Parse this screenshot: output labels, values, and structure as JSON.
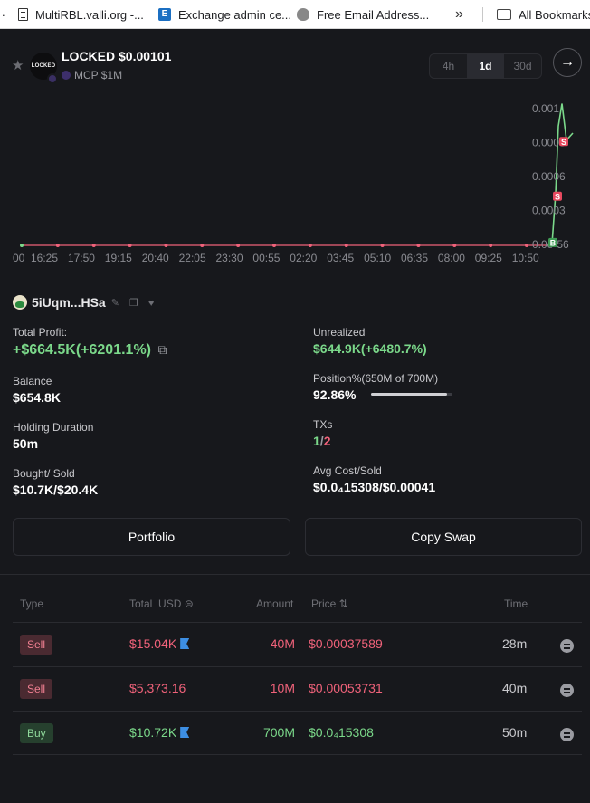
{
  "bookmarks": {
    "left_stub": ".",
    "items": [
      {
        "label": "MultiRBL.valli.org -...",
        "icon": "document-icon"
      },
      {
        "label": "Exchange admin ce...",
        "icon": "exchange-icon"
      },
      {
        "label": "Free Email Address...",
        "icon": "free-email-icon"
      }
    ],
    "overflow": "»",
    "all": "All Bookmarks"
  },
  "header": {
    "logo_text": "LOCKED",
    "title": "LOCKED $0.00101",
    "mcp": "MCP $1M",
    "timeframes": [
      "4h",
      "1d",
      "30d"
    ],
    "active_timeframe": "1d",
    "go_glyph": "→"
  },
  "chart_data": {
    "type": "line",
    "x_ticks": [
      "00",
      "16:25",
      "17:50",
      "19:15",
      "20:40",
      "22:05",
      "23:30",
      "00:55",
      "02:20",
      "03:45",
      "05:10",
      "06:35",
      "08:00",
      "09:25",
      "10:50"
    ],
    "y_ticks": [
      "0.001",
      "0.0008",
      "0.0006",
      "0.0003",
      "0.0e-56"
    ],
    "ylim": [
      0,
      0.001
    ],
    "series": [
      {
        "color": "#f0627a",
        "values_desc": "flat near zero then trade markers",
        "values": [
          0,
          0,
          0,
          0,
          0,
          0,
          0,
          0,
          0,
          0,
          0,
          0,
          0,
          0,
          0
        ]
      },
      {
        "color": "#7bd88a",
        "spike": [
          1e-05,
          0.00037,
          0.00085,
          0.00101,
          0.00075,
          0.0008
        ]
      }
    ],
    "markers": [
      {
        "label": "S",
        "value": 0.00074,
        "kind": "sell"
      },
      {
        "label": "S",
        "value": 0.00035,
        "kind": "sell"
      },
      {
        "label": "B",
        "value": 2e-05,
        "kind": "buy"
      }
    ],
    "colors": {
      "line": "#7bd88a",
      "baseline": "#f0627a"
    }
  },
  "trader": {
    "name": "5iUqm...HSa",
    "icons": "✎ ❐ ♥"
  },
  "stats": {
    "total_profit_label": "Total Profit:",
    "total_profit_value": "+$664.5K(+6201.1%)",
    "share_glyph": "⧉",
    "unrealized_label": "Unrealized",
    "unrealized_value": "$644.9K(+6480.7%)",
    "balance_label": "Balance",
    "balance_value": "$654.8K",
    "position_label": "Position%(650M of 700M)",
    "position_value": "92.86%",
    "position_fraction": 0.9286,
    "holding_label": "Holding Duration",
    "holding_value": "50m",
    "txs_label": "TXs",
    "txs_buy": "1",
    "txs_sep": "/",
    "txs_sell": "2",
    "bought_sold_label": "Bought/ Sold",
    "bought_sold_value": "$10.7K/$20.4K",
    "avg_cost_label": "Avg Cost/Sold",
    "avg_cost_value": "$0.0₄15308/$0.00041"
  },
  "buttons": {
    "portfolio": "Portfolio",
    "copy_swap": "Copy Swap"
  },
  "table": {
    "headers": {
      "type": "Type",
      "total": "Total",
      "usd": "USD ⊜",
      "amount": "Amount",
      "price": "Price ⇅",
      "time": "Time"
    },
    "rows": [
      {
        "type": "Sell",
        "total": "$15.04K",
        "flag": true,
        "amount": "40M",
        "price": "$0.00037589",
        "time": "28m"
      },
      {
        "type": "Sell",
        "total": "$5,373.16",
        "flag": false,
        "amount": "10M",
        "price": "$0.00053731",
        "time": "40m"
      },
      {
        "type": "Buy",
        "total": "$10.72K",
        "flag": true,
        "amount": "700M",
        "price": "$0.0₄15308",
        "time": "50m"
      }
    ]
  }
}
